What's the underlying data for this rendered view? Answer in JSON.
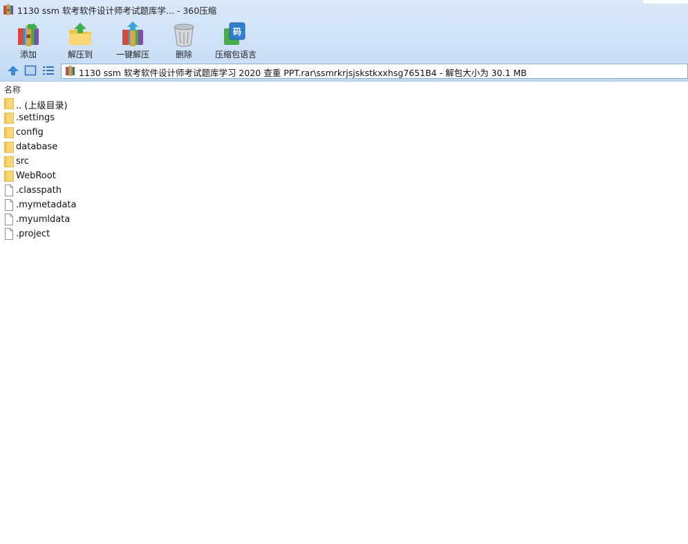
{
  "window": {
    "title": "1130 ssm 软考软件设计师考试题库学... - 360压缩"
  },
  "toolbar": {
    "items": [
      {
        "label": "添加",
        "icon": "add-archive-icon"
      },
      {
        "label": "解压到",
        "icon": "extract-to-folder-icon"
      },
      {
        "label": "一键解压",
        "icon": "one-click-extract-icon"
      },
      {
        "label": "删除",
        "icon": "trash-can-icon"
      },
      {
        "label": "压缩包语言",
        "icon": "archive-language-icon"
      }
    ]
  },
  "address": {
    "path": "1130 ssm 软考软件设计师考试题库学习  2020 查重 PPT.rar\\ssmrkrjsjskstkxxhsg7651B4 - 解包大小为 30.1 MB"
  },
  "filelist": {
    "column_name": "名称",
    "items": [
      {
        "name": ".. (上级目录)",
        "type": "folder"
      },
      {
        "name": ".settings",
        "type": "folder"
      },
      {
        "name": "config",
        "type": "folder"
      },
      {
        "name": "database",
        "type": "folder"
      },
      {
        "name": "src",
        "type": "folder"
      },
      {
        "name": "WebRoot",
        "type": "folder"
      },
      {
        "name": ".classpath",
        "type": "file"
      },
      {
        "name": ".mymetadata",
        "type": "file"
      },
      {
        "name": ".myumldata",
        "type": "file"
      },
      {
        "name": ".project",
        "type": "file"
      }
    ]
  },
  "colors": {
    "toolbar_bg": "#d6e6f8",
    "folder": "#f8d775",
    "accent": "#3b8ad8"
  }
}
